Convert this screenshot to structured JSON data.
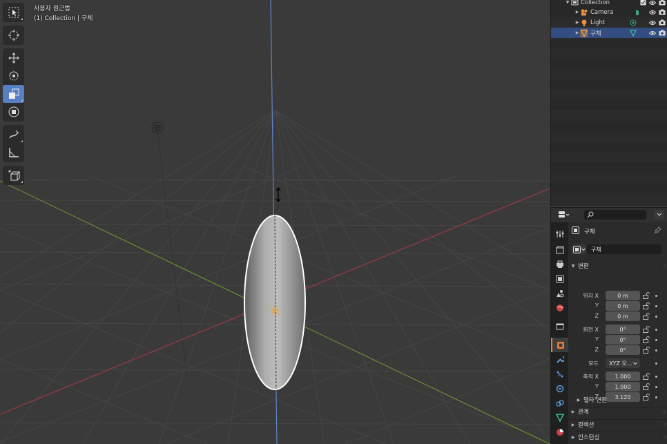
{
  "viewport": {
    "info_line1": "사용자 원근법",
    "info_line2": "(1) Collection | 구체"
  },
  "toolbar": {
    "tools": [
      "select-box",
      "cursor",
      "move",
      "rotate",
      "scale",
      "transform",
      "annotate",
      "measure",
      "add-cube"
    ],
    "active_tool": "scale"
  },
  "outliner": {
    "collection_label": "Collection",
    "items": [
      {
        "label": "Camera",
        "icon": "camera-icon"
      },
      {
        "label": "Light",
        "icon": "light-icon"
      },
      {
        "label": "구체",
        "icon": "mesh-icon"
      }
    ]
  },
  "properties": {
    "search_placeholder": "",
    "object_name_header": "구체",
    "object_name_field": "구체",
    "transform_section": "변환",
    "location": {
      "label": "위치",
      "x": "0 m",
      "y": "0 m",
      "z": "0 m"
    },
    "rotation": {
      "label": "회전",
      "x": "0°",
      "y": "0°",
      "z": "0°"
    },
    "mode": {
      "label": "모드",
      "value": "XYZ 오..."
    },
    "scale": {
      "label": "축적",
      "x": "1.000",
      "y": "1.000",
      "z": "3.120"
    },
    "axis_labels": {
      "x": "X",
      "y": "Y",
      "z": "Z"
    },
    "delta_transform": "델타 변환",
    "relations": "관계",
    "collections": "컬렉션",
    "instancing": "인스턴싱"
  },
  "colors": {
    "active_tool": "#5680c2",
    "selected_row": "#334d80",
    "x_axis": "#9c3a44",
    "y_axis": "#6a8e2c",
    "z_axis": "#5d86c8",
    "active_tab": "#e8813a"
  }
}
